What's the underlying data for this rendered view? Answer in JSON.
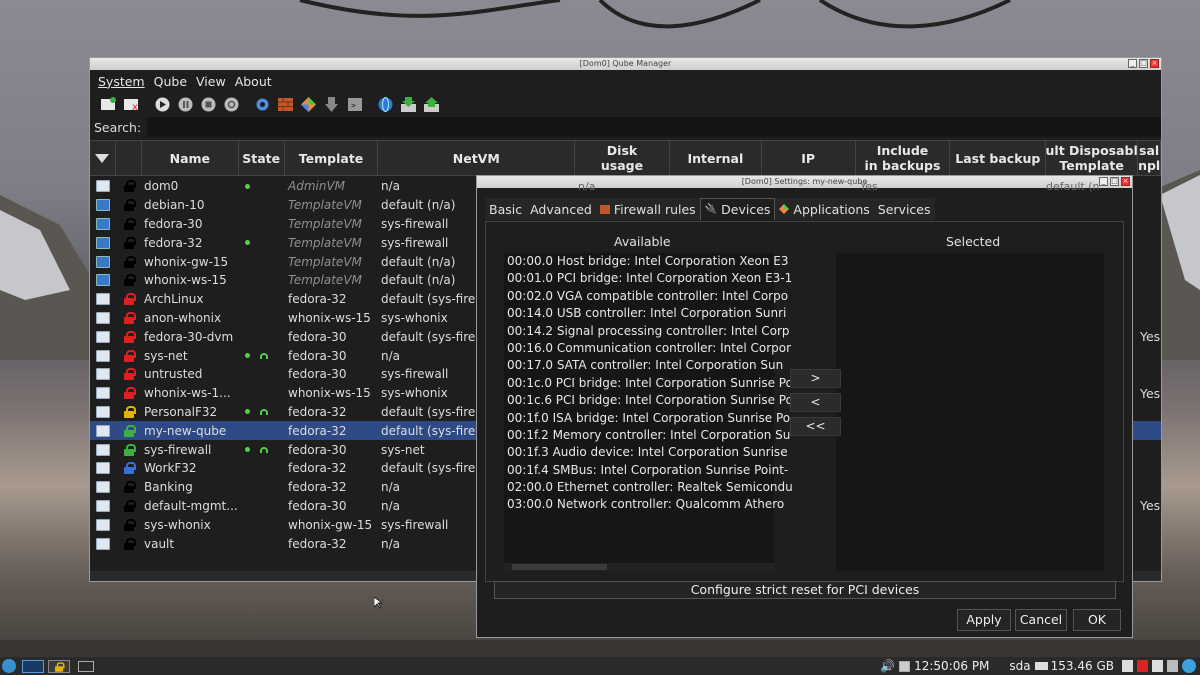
{
  "manager": {
    "title": "[Dom0] Qube Manager",
    "menu": [
      "System",
      "Qube",
      "View",
      "About"
    ],
    "search_label": "Search:",
    "columns": [
      "Name",
      "State",
      "Template",
      "NetVM",
      "Disk\nusage",
      "Internal",
      "IP",
      "Include\nin backups",
      "Last backup",
      "ult Disposabl\nTemplate",
      "sal\nnpl"
    ],
    "rows": [
      {
        "name": "dom0",
        "lock": "#000000",
        "icon": "dom0",
        "template": "AdminVM",
        "tplvm": true,
        "netvm": "n/a",
        "dot": true,
        "net": false
      },
      {
        "name": "debian-10",
        "lock": "#000000",
        "icon": "tv",
        "template": "TemplateVM",
        "tplvm": true,
        "netvm": "default (n/a)",
        "dot": false,
        "net": false
      },
      {
        "name": "fedora-30",
        "lock": "#000000",
        "icon": "tv",
        "template": "TemplateVM",
        "tplvm": true,
        "netvm": "sys-firewall",
        "dot": false,
        "net": false
      },
      {
        "name": "fedora-32",
        "lock": "#000000",
        "icon": "tv",
        "template": "TemplateVM",
        "tplvm": true,
        "netvm": "sys-firewall",
        "dot": true,
        "net": false
      },
      {
        "name": "whonix-gw-15",
        "lock": "#000000",
        "icon": "tv",
        "template": "TemplateVM",
        "tplvm": true,
        "netvm": "default (n/a)",
        "dot": false,
        "net": false
      },
      {
        "name": "whonix-ws-15",
        "lock": "#000000",
        "icon": "tv",
        "template": "TemplateVM",
        "tplvm": true,
        "netvm": "default (n/a)",
        "dot": false,
        "net": false
      },
      {
        "name": "ArchLinux",
        "lock": "#e02020",
        "icon": "vm",
        "template": "fedora-32",
        "tplvm": false,
        "netvm": "default (sys-firew",
        "dot": false,
        "net": false
      },
      {
        "name": "anon-whonix",
        "lock": "#e02020",
        "icon": "vm",
        "template": "whonix-ws-15",
        "tplvm": false,
        "netvm": "sys-whonix",
        "dot": false,
        "net": false
      },
      {
        "name": "fedora-30-dvm",
        "lock": "#e02020",
        "icon": "vm",
        "template": "fedora-30",
        "tplvm": false,
        "netvm": "default (sys-firew",
        "dot": false,
        "net": false,
        "yes": "Yes"
      },
      {
        "name": "sys-net",
        "lock": "#e02020",
        "icon": "vm",
        "template": "fedora-30",
        "tplvm": false,
        "netvm": "n/a",
        "dot": true,
        "net": true
      },
      {
        "name": "untrusted",
        "lock": "#e02020",
        "icon": "vm",
        "template": "fedora-30",
        "tplvm": false,
        "netvm": "sys-firewall",
        "dot": false,
        "net": false
      },
      {
        "name": "whonix-ws-1...",
        "lock": "#e02020",
        "icon": "vm",
        "template": "whonix-ws-15",
        "tplvm": false,
        "netvm": "sys-whonix",
        "dot": false,
        "net": false,
        "yes": "Yes"
      },
      {
        "name": "PersonalF32",
        "lock": "#e6b400",
        "icon": "vm",
        "template": "fedora-32",
        "tplvm": false,
        "netvm": "default (sys-firew",
        "dot": true,
        "net": true
      },
      {
        "name": "my-new-qube",
        "lock": "#3cb043",
        "icon": "vm",
        "template": "fedora-32",
        "tplvm": false,
        "netvm": "default (sys-firew",
        "dot": false,
        "net": false,
        "sel": true
      },
      {
        "name": "sys-firewall",
        "lock": "#3cb043",
        "icon": "vm",
        "template": "fedora-30",
        "tplvm": false,
        "netvm": "sys-net",
        "dot": true,
        "net": true
      },
      {
        "name": "WorkF32",
        "lock": "#3a6fd8",
        "icon": "vm",
        "template": "fedora-32",
        "tplvm": false,
        "netvm": "default (sys-firew",
        "dot": false,
        "net": false
      },
      {
        "name": "Banking",
        "lock": "#000000",
        "icon": "vm",
        "template": "fedora-32",
        "tplvm": false,
        "netvm": "n/a",
        "dot": false,
        "net": false
      },
      {
        "name": "default-mgmt...",
        "lock": "#000000",
        "icon": "vm",
        "template": "fedora-30",
        "tplvm": false,
        "netvm": "n/a",
        "dot": false,
        "net": false,
        "yes": "Yes"
      },
      {
        "name": "sys-whonix",
        "lock": "#000000",
        "icon": "vm",
        "template": "whonix-gw-15",
        "tplvm": false,
        "netvm": "sys-firewall",
        "dot": false,
        "net": false
      },
      {
        "name": "vault",
        "lock": "#000000",
        "icon": "vm",
        "template": "fedora-32",
        "tplvm": false,
        "netvm": "n/a",
        "dot": false,
        "net": false
      }
    ],
    "peek": {
      "disk": "n/a",
      "yes": "Yes",
      "disp": "default (n"
    }
  },
  "settings": {
    "title": "[Dom0] Settings: my-new-qube",
    "tabs": [
      "Basic",
      "Advanced",
      "Firewall rules",
      "Devices",
      "Applications",
      "Services"
    ],
    "available_label": "Available",
    "selected_label": "Selected",
    "devices": [
      "00:00.0 Host bridge: Intel Corporation Xeon E3",
      "00:01.0 PCI bridge: Intel Corporation Xeon E3-1",
      "00:02.0 VGA compatible controller: Intel Corpo",
      "00:14.0 USB controller: Intel Corporation Sunri",
      "00:14.2 Signal processing controller: Intel Corp",
      "00:16.0 Communication controller: Intel Corpor",
      "00:17.0 SATA controller: Intel Corporation Sun",
      "00:1c.0 PCI bridge: Intel Corporation Sunrise Po",
      "00:1c.6 PCI bridge: Intel Corporation Sunrise Po",
      "00:1f.0 ISA bridge: Intel Corporation Sunrise Po",
      "00:1f.2 Memory controller: Intel Corporation Su",
      "00:1f.3 Audio device: Intel Corporation Sunrise",
      "00:1f.4 SMBus: Intel Corporation Sunrise Point-",
      "02:00.0 Ethernet controller: Realtek Semicondu",
      "03:00.0 Network controller: Qualcomm Athero"
    ],
    "add": ">",
    "remove": "<",
    "remove_all": "<<",
    "strict_reset": "Configure strict reset for PCI devices",
    "apply": "Apply",
    "cancel": "Cancel",
    "ok": "OK"
  },
  "taskbar": {
    "time": "12:50:06 PM",
    "disk": "sda",
    "size": "153.46 GB"
  }
}
